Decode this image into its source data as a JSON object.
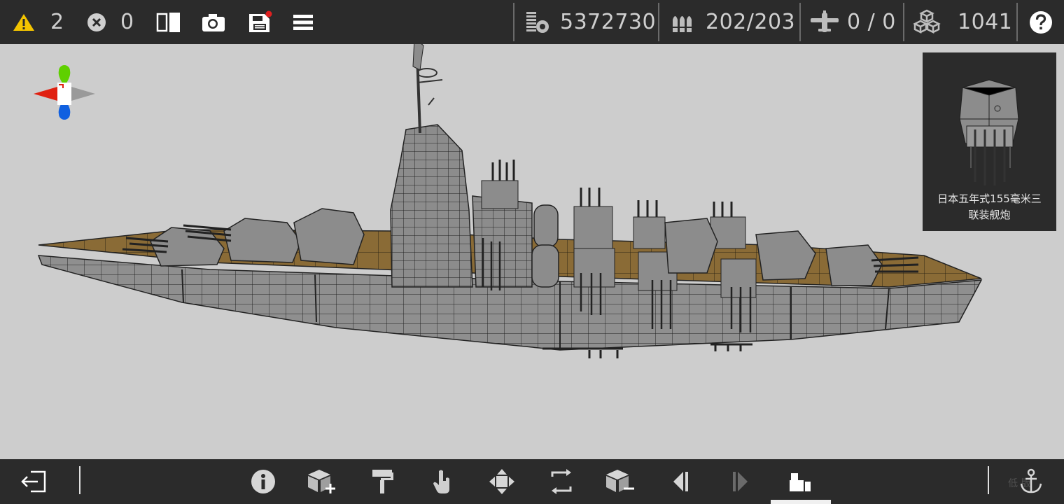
{
  "toolbar": {
    "warnings": {
      "icon": "warning-icon",
      "value": "2"
    },
    "errors": {
      "icon": "error-icon",
      "value": "0"
    },
    "stats": {
      "weight": {
        "icon": "weight-icon",
        "value": "5372730"
      },
      "ammo": {
        "icon": "ammo-icon",
        "value": "202/203"
      },
      "aircraft": {
        "icon": "aircraft-icon",
        "value": "0 / 0"
      },
      "parts": {
        "icon": "parts-icon",
        "value": "1041"
      }
    },
    "buttons": [
      "mirror-icon",
      "camera-icon",
      "save-icon",
      "menu-icon",
      "help-icon"
    ]
  },
  "preview": {
    "label_line1": "日本五年式155毫米三",
    "label_line2": "联装舰炮"
  },
  "bottom_toolbar": {
    "buttons": [
      "exit-icon",
      "info-icon",
      "add-part-icon",
      "paint-icon",
      "touch-select-icon",
      "move-icon",
      "rotate-icon",
      "remove-part-icon",
      "undo-icon",
      "redo-icon",
      "parts-library-icon",
      "anchor-icon"
    ],
    "active": "parts-library-icon"
  },
  "watermark": "低  版",
  "colors": {
    "bar": "#2b2b2b",
    "viewport": "#cdcdcd",
    "deck": "#8a6b36",
    "hull": "#8f8f8f",
    "warning": "#f3c400",
    "notification_dot": "#e02020",
    "axis_x": "#e02010",
    "axis_y": "#5fd000",
    "axis_z": "#1060e0"
  }
}
